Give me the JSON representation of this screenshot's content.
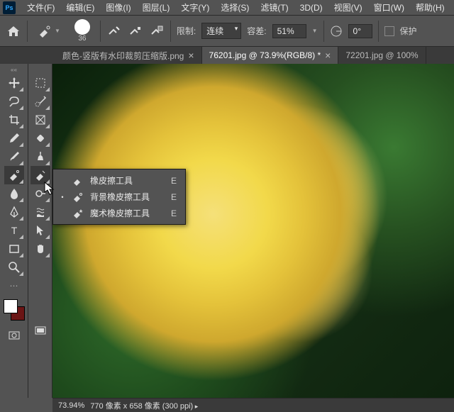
{
  "menu": [
    "文件(F)",
    "编辑(E)",
    "图像(I)",
    "图层(L)",
    "文字(Y)",
    "选择(S)",
    "滤镜(T)",
    "3D(D)",
    "视图(V)",
    "窗口(W)",
    "帮助(H)"
  ],
  "options": {
    "brush_size": "36",
    "limit_label": "限制:",
    "limit_value": "连续",
    "tolerance_label": "容差:",
    "tolerance_value": "51%",
    "angle_value": "0°",
    "protect_label": "保护"
  },
  "tabs": [
    {
      "label": "颜色-竖版有水印裁剪压缩版.png",
      "active": false
    },
    {
      "label": "76201.jpg @ 73.9%(RGB/8) *",
      "active": true
    },
    {
      "label": "72201.jpg @ 100%",
      "active": false
    }
  ],
  "flyout": {
    "items": [
      {
        "mark": "",
        "label": "橡皮擦工具",
        "key": "E"
      },
      {
        "mark": "•",
        "label": "背景橡皮擦工具",
        "key": "E"
      },
      {
        "mark": "",
        "label": "魔术橡皮擦工具",
        "key": "E"
      }
    ]
  },
  "status": {
    "zoom": "73.94%",
    "dims": "770 像素 x 658 像素 (300 ppi)"
  }
}
